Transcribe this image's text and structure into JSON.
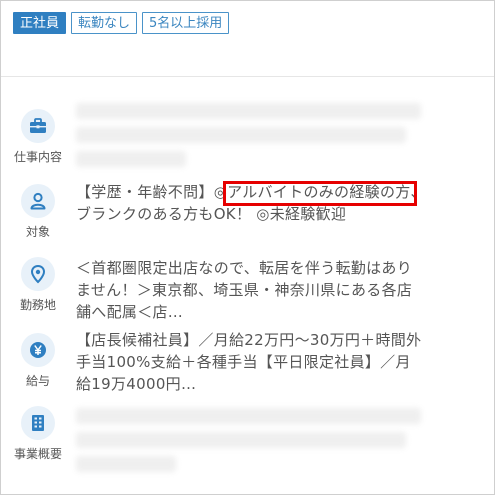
{
  "tags": [
    {
      "label": "正社員"
    },
    {
      "label": "転勤なし"
    },
    {
      "label": "5名以上採用"
    }
  ],
  "sections": [
    {
      "icon": "briefcase-icon",
      "label": "仕事内容",
      "text": ""
    },
    {
      "icon": "person-icon",
      "label": "対象",
      "text": "【学歴・年齢不問】◎アルバイトのみの経験の方、ブランクのある方もOK！ ◎未経験歓迎"
    },
    {
      "icon": "location-pin-icon",
      "label": "勤務地",
      "text": "＜首都圏限定出店なので、転居を伴う転勤はありません！＞東京都、埼玉県・神奈川県にある各店舗へ配属＜店…"
    },
    {
      "icon": "yen-icon",
      "label": "給与",
      "text": "【店長候補社員】／月給22万円〜30万円＋時間外手当100%支給＋各種手当【平日限定社員】／月給19万4000円…"
    },
    {
      "icon": "building-icon",
      "label": "事業概要",
      "text": ""
    }
  ],
  "colors": {
    "accent": "#2f7fc1",
    "highlight": "#e60000",
    "icon_bg": "#e8f1f9"
  }
}
